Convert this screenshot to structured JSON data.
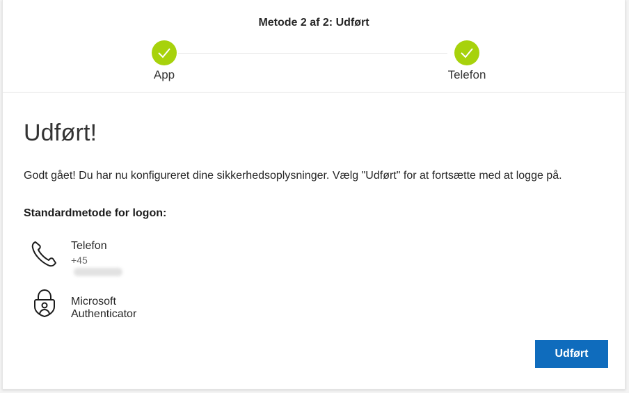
{
  "header": {
    "step_title": "Metode 2 af 2: Udført",
    "steps": [
      {
        "label": "App",
        "status": "done"
      },
      {
        "label": "Telefon",
        "status": "done"
      }
    ]
  },
  "content": {
    "heading": "Udført!",
    "description": "Godt gået! Du har nu konfigureret dine sikkerhedsoplysninger. Vælg \"Udført\" for at fortsætte med at logge på.",
    "default_method_label": "Standardmetode for logon:",
    "methods": [
      {
        "name": "Telefon",
        "detail": "+45",
        "icon": "phone-icon"
      },
      {
        "name": "Microsoft Authenticator",
        "icon": "authenticator-lock-icon"
      }
    ]
  },
  "footer": {
    "done_label": "Udført"
  },
  "colors": {
    "accent": "#0f6cbd",
    "step_complete": "#a7d20c"
  }
}
